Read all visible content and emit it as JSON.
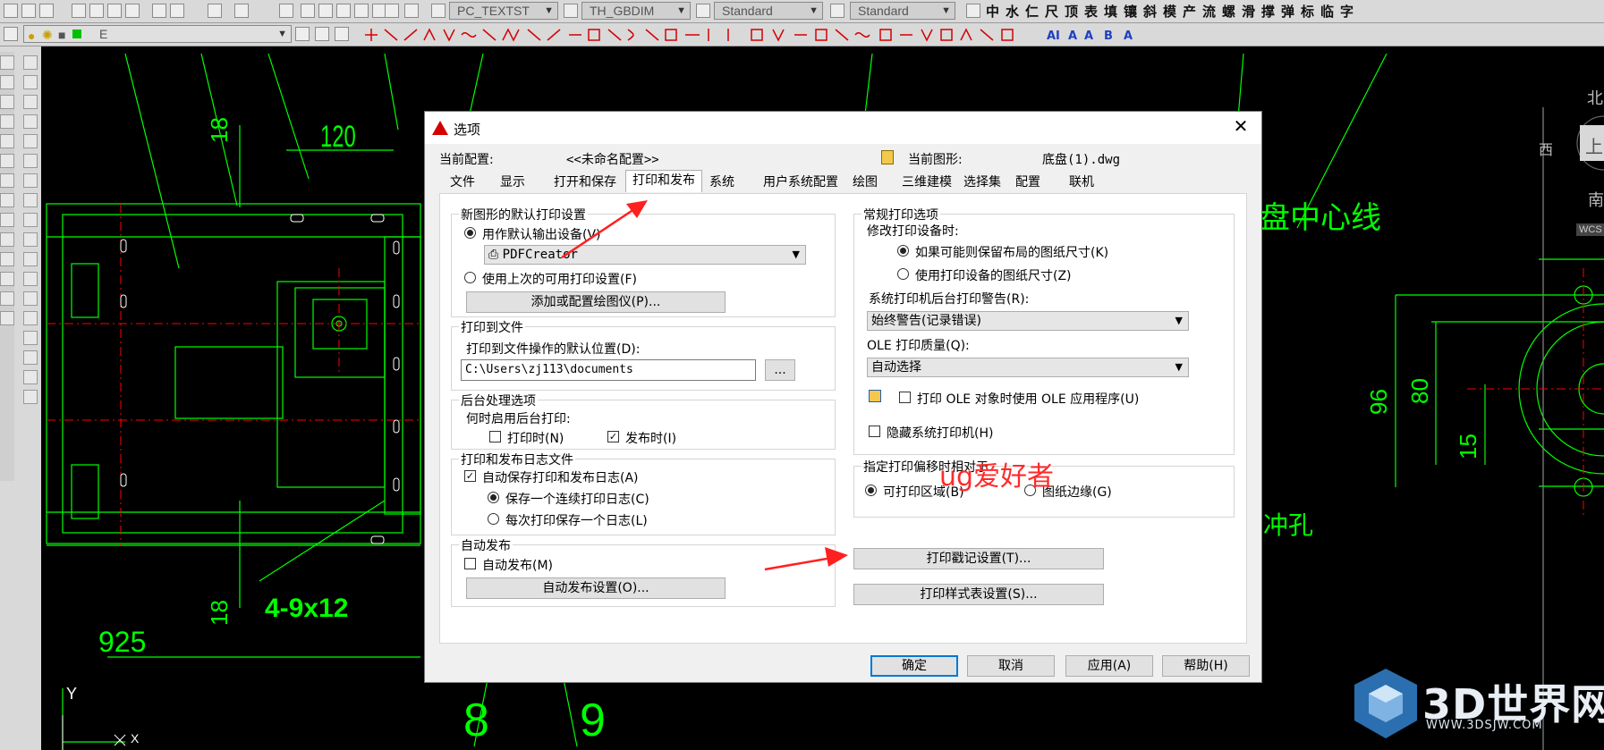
{
  "toolbar": {
    "text_style_combo": "PC_TEXTST",
    "dim_style_combo": "TH_GBDIM",
    "table_style_combo": "Standard",
    "multileader_style_combo": "Standard",
    "font_chars": "中水仁尺顶表填镶斜模产流螺滑撑弹标临字",
    "layer_combo": "E"
  },
  "dialog": {
    "title": "选项",
    "close_glyph": "✕",
    "current_profile_label": "当前配置:",
    "current_profile_value": "<<未命名配置>>",
    "current_drawing_label": "当前图形:",
    "current_drawing_value": "底盘(1).dwg",
    "tabs": [
      "文件",
      "显示",
      "打开和保存",
      "打印和发布",
      "系统",
      "用户系统配置",
      "绘图",
      "三维建模",
      "选择集",
      "配置",
      "联机"
    ],
    "new_drawing_group": {
      "title": "新图形的默认打印设置",
      "use_default_device": "用作默认输出设备(V)",
      "device_value": "PDFCreator",
      "use_last": "使用上次的可用打印设置(F)",
      "add_plotter_button": "添加或配置绘图仪(P)..."
    },
    "plot_to_file_group": {
      "title": "打印到文件",
      "default_location_label": "打印到文件操作的默认位置(D):",
      "path_value": "C:\\Users\\zj113\\documents",
      "browse_button": "..."
    },
    "background_group": {
      "title": "后台处理选项",
      "when_label": "何时启用后台打印:",
      "when_plotting": "打印时(N)",
      "when_publishing": "发布时(I)"
    },
    "log_group": {
      "title": "打印和发布日志文件",
      "auto_save": "自动保存打印和发布日志(A)",
      "continuous": "保存一个连续打印日志(C)",
      "per_plot": "每次打印保存一个日志(L)"
    },
    "autopublish_group": {
      "title": "自动发布",
      "auto_publish": "自动发布(M)",
      "settings_button": "自动发布设置(O)..."
    },
    "general_group": {
      "title": "常规打印选项",
      "change_device_label": "修改打印设备时:",
      "keep_layout_size": "如果可能则保留布局的图纸尺寸(K)",
      "use_device_size": "使用打印设备的图纸尺寸(Z)",
      "spool_alert_label": "系统打印机后台打印警告(R):",
      "spool_alert_value": "始终警告(记录错误)",
      "ole_quality_label": "OLE 打印质量(Q):",
      "ole_quality_value": "自动选择",
      "use_ole_app": "打印 OLE 对象时使用 OLE 应用程序(U)",
      "hide_system_printers": "隐藏系统打印机(H)"
    },
    "offset_group": {
      "title": "指定打印偏移时相对于",
      "printable_area": "可打印区域(B)",
      "paper_edge": "图纸边缘(G)"
    },
    "plot_stamp_button": "打印戳记设置(T)...",
    "plot_style_button": "打印样式表设置(S)...",
    "ok_button": "确定",
    "cancel_button": "取消",
    "apply_button": "应用(A)",
    "help_button": "帮助(H)"
  },
  "overlay": {
    "watermark_text": "ug爱好者",
    "site_logo_text": "3D世界网",
    "site_url": "WWW.3DSJW.COM"
  },
  "cad": {
    "dim_120": "120",
    "dim_18_top": "18",
    "dim_18_bottom": "18",
    "dim_hole": "4-9x12",
    "dim_925": "925",
    "num_8": "8",
    "num_9": "9",
    "axis_y": "Y",
    "axis_x": "X",
    "label_centerline": "盘中心线",
    "label_punch": "冲孔",
    "dim_96": "96",
    "dim_80": "80",
    "dim_15": "15",
    "compass_north": "北",
    "compass_west": "西",
    "compass_south": "南",
    "compass_top": "上",
    "compass_wcs": "WCS"
  },
  "colors": {
    "cad_background": "#000000",
    "cad_lines": "#00ff00",
    "cad_centerlines": "#ff0000",
    "annotation_arrow": "#ff2020",
    "dialog_background": "#f0f0f0",
    "default_button_border": "#0078d7",
    "logo_blue": "#1f6fb5"
  }
}
